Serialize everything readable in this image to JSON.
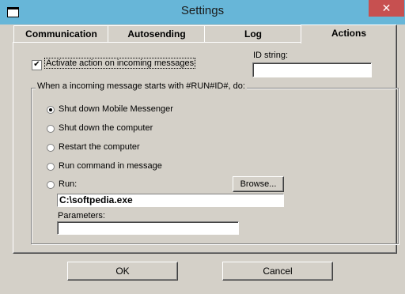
{
  "window": {
    "title": "Settings",
    "close_glyph": "✕"
  },
  "tabs": [
    {
      "label": "Communication"
    },
    {
      "label": "Autosending"
    },
    {
      "label": "Log"
    },
    {
      "label": "Actions"
    }
  ],
  "actions": {
    "activate_label": "Activate action on incoming messages",
    "activate_checked": true,
    "id_string_label": "ID string:",
    "id_string_value": "",
    "group_title": "When a incoming message starts with #RUN#ID#, do:",
    "options": [
      {
        "label": "Shut down Mobile Messenger",
        "selected": true
      },
      {
        "label": "Shut down the computer",
        "selected": false
      },
      {
        "label": "Restart the computer",
        "selected": false
      },
      {
        "label": "Run command in message",
        "selected": false
      },
      {
        "label": "Run:",
        "selected": false
      }
    ],
    "browse_label": "Browse...",
    "run_path": "C:\\softpedia.exe",
    "parameters_label": "Parameters:",
    "parameters_value": ""
  },
  "footer": {
    "ok_label": "OK",
    "cancel_label": "Cancel"
  }
}
